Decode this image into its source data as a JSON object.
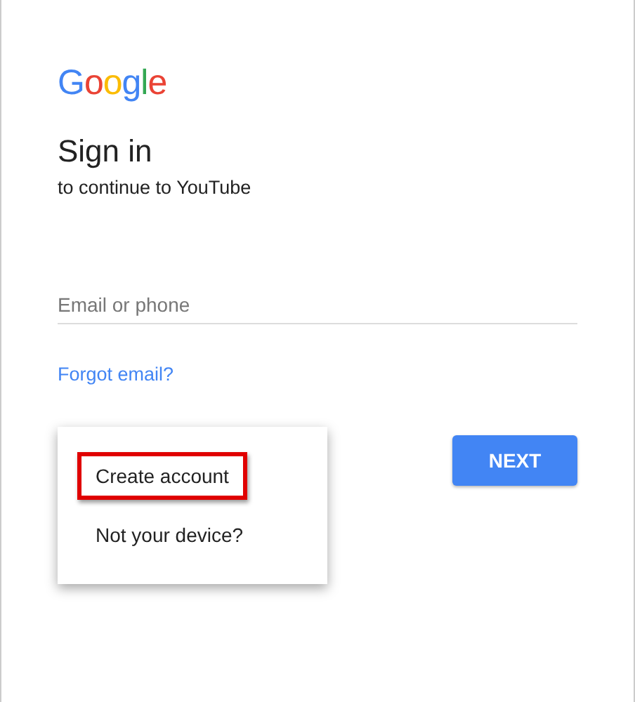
{
  "logo": "Google",
  "title": "Sign in",
  "subtitle": "to continue to YouTube",
  "email_field": {
    "placeholder": "Email or phone"
  },
  "forgot_link": "Forgot email?",
  "menu": {
    "items": [
      {
        "label": "Create account",
        "highlighted": true
      },
      {
        "label": "Not your device?",
        "highlighted": false
      }
    ]
  },
  "next_button": "NEXT"
}
